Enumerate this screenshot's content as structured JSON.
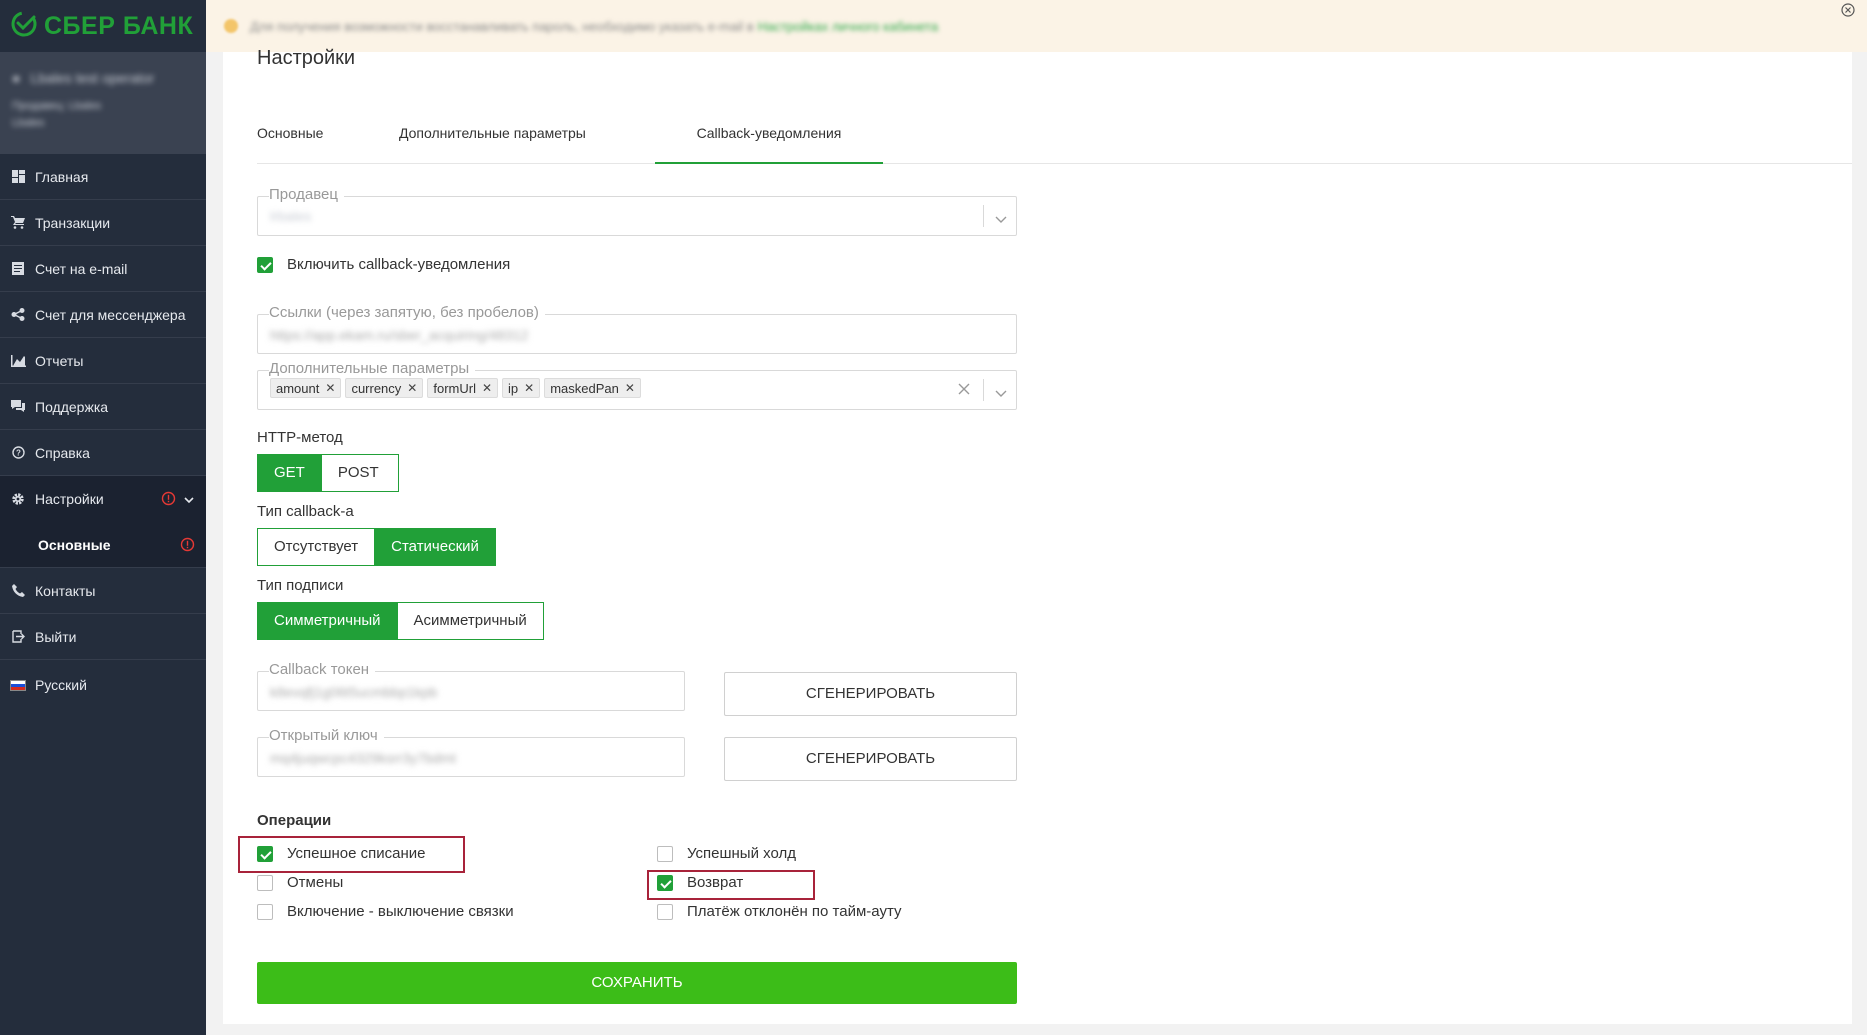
{
  "brand": {
    "name": "СБЕР БАНК",
    "color": "#21a038"
  },
  "user": {
    "name": "Lbales test operator",
    "sub1": "Продавец: Lbales",
    "sub2": "Lbales"
  },
  "sidebar": {
    "items": [
      {
        "label": "Главная",
        "icon": "dashboard-icon"
      },
      {
        "label": "Транзакции",
        "icon": "cart-icon"
      },
      {
        "label": "Счет на e-mail",
        "icon": "invoice-icon"
      },
      {
        "label": "Счет для мессенджера",
        "icon": "share-icon"
      },
      {
        "label": "Отчеты",
        "icon": "chart-icon"
      },
      {
        "label": "Поддержка",
        "icon": "chat-icon"
      },
      {
        "label": "Справка",
        "icon": "help-icon"
      },
      {
        "label": "Настройки",
        "icon": "gear-icon"
      },
      {
        "label": "Основные"
      },
      {
        "label": "Контакты",
        "icon": "phone-icon"
      },
      {
        "label": "Выйти",
        "icon": "logout-icon"
      },
      {
        "label": "Русский",
        "icon": "flag-ru-icon"
      }
    ]
  },
  "notice": {
    "text": "Для получения возможности восстанавливать пароль, необходимо указать e-mail в",
    "link": "Настройках личного кабинета"
  },
  "page": {
    "title": "Настройки"
  },
  "tabs": [
    "Основные",
    "Дополнительные параметры",
    "Callback-уведомления"
  ],
  "form": {
    "seller": {
      "label": "Продавец",
      "value": "lrbales"
    },
    "enable_callback": {
      "label": "Включить callback-уведомления",
      "checked": true
    },
    "urls": {
      "label": "Ссылки (через запятую, без пробелов)",
      "value": "https://app.ekam.ru/sber_acquiring/48312"
    },
    "extra_params": {
      "label": "Дополнительные параметры",
      "chips": [
        "amount",
        "currency",
        "formUrl",
        "ip",
        "maskedPan"
      ]
    },
    "http_method": {
      "label": "HTTP-метод",
      "options": [
        "GET",
        "POST"
      ],
      "selected": "GET"
    },
    "callback_type": {
      "label": "Тип callback-а",
      "options": [
        "Отсутствует",
        "Статический"
      ],
      "selected": "Статический"
    },
    "sign_type": {
      "label": "Тип подписи",
      "options": [
        "Симметричный",
        "Асимметричный"
      ],
      "selected": "Симметричный"
    },
    "callback_token": {
      "label": "Callback токен",
      "value": "k8evqfj1g06t5ucmbbp1kpb",
      "button": "СГЕНЕРИРОВАТЬ"
    },
    "public_key": {
      "label": "Открытый ключ",
      "value": "mq4juqwcpc4329ksrr3y7bdmt",
      "button": "СГЕНЕРИРОВАТЬ"
    },
    "operations": {
      "title": "Операции",
      "left": [
        {
          "label": "Успешное списание",
          "checked": true
        },
        {
          "label": "Отмены",
          "checked": false
        },
        {
          "label": "Включение - выключение связки",
          "checked": false
        }
      ],
      "right": [
        {
          "label": "Успешный холд",
          "checked": false
        },
        {
          "label": "Возврат",
          "checked": true
        },
        {
          "label": "Платёж отклонён по тайм-ауту",
          "checked": false
        }
      ]
    },
    "save": "СОХРАНИТЬ"
  },
  "colors": {
    "accent": "#21a038",
    "save": "#3cbd18",
    "sidebar": "#242d3c",
    "highlight": "#a8233a",
    "warning": "#e53935"
  }
}
